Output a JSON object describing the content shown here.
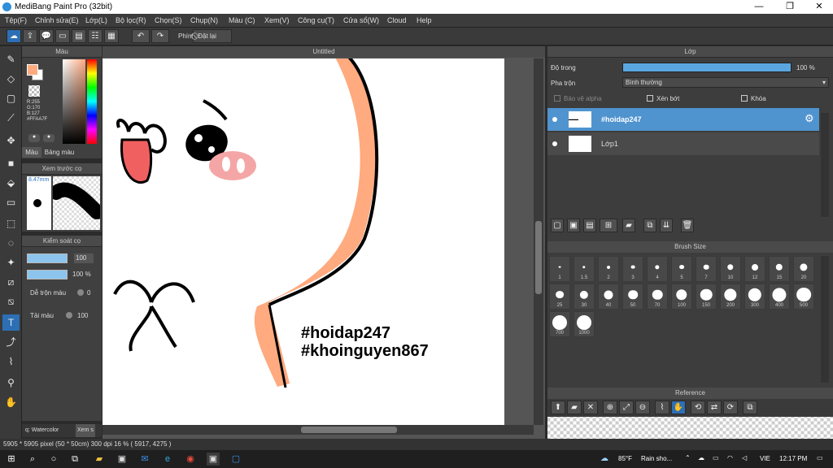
{
  "window": {
    "title": "MediBang Paint Pro (32bit)",
    "min": "—",
    "max": "❐",
    "close": "✕"
  },
  "menu": [
    "Tệp(F)",
    "Chỉnh sửa(E)",
    "Lớp(L)",
    "Bộ lọc(R)",
    "Chọn(S)",
    "Chụp(N)",
    "Màu (C)",
    "Xem(V)",
    "Công cụ(T)",
    "Cửa sổ(W)",
    "Cloud",
    "Help"
  ],
  "toolbar": {
    "phim_label": "Phím",
    "reset_label": "Đặt lại"
  },
  "color_panel": {
    "title": "Màu",
    "rgb": [
      "R:255",
      "G:170",
      "B:127"
    ],
    "hex": "#FFAA7F",
    "tab_color": "Màu",
    "tab_palette": "Bảng màu",
    "primary": "#FFAA7F"
  },
  "brush_preview": {
    "title": "Xem trước cọ",
    "size": "8.47mm"
  },
  "brush_control": {
    "title": "Kiểm soát cọ",
    "size_value": "100",
    "opacity_value": "100 %",
    "blend_label": "Dễ trộn màu",
    "blend_value": "0",
    "reload_label": "Tải màu",
    "reload_value": "100"
  },
  "left_bottom_tabs": [
    "q: Watercolor",
    "Xem s"
  ],
  "canvas": {
    "tab": "Untitled",
    "text1": "#hoidap247",
    "text2": "#khoinguyen867"
  },
  "layers": {
    "title": "Lớp",
    "opacity_label": "Độ trong",
    "opacity_value": "100 %",
    "opacity_level": 1.0,
    "blend_label": "Pha trộn",
    "blend_value": "Bình thường",
    "protect_alpha": "Bảo vệ alpha",
    "clipping": "Xén bớt",
    "lock": "Khóa",
    "items": [
      {
        "name": "#hoidap247",
        "selected": true
      },
      {
        "name": "Lớp1",
        "selected": false
      }
    ]
  },
  "brush_size": {
    "title": "Brush Size",
    "sizes": [
      "1",
      "1.5",
      "2",
      "3",
      "4",
      "5",
      "7",
      "10",
      "12",
      "15",
      "20",
      "25",
      "30",
      "40",
      "50",
      "70",
      "100",
      "150",
      "200",
      "300",
      "400",
      "500",
      "700",
      "1000"
    ]
  },
  "reference": {
    "title": "Reference"
  },
  "status": {
    "text": "5905 * 5905 pixel    (50 * 50cm)    300 dpi    16 %    ( 5917, 4275 )"
  },
  "taskbar": {
    "weather_temp": "85°F",
    "weather_text": "Rain sho...",
    "lang": "VIE",
    "time": "12:17 PM"
  }
}
